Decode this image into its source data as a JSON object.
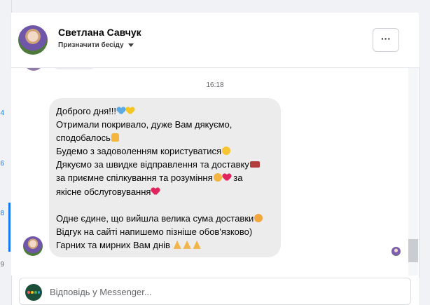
{
  "left_strip": {
    "badges": [
      "4",
      "6",
      "8",
      "9"
    ]
  },
  "header": {
    "contact_name": "Светлана Савчук",
    "subtitle": "Призначити бесіду",
    "more_label": "···"
  },
  "conversation": {
    "timestamp": "16:18",
    "message_lines": [
      "Доброго дня!!!",
      "Отримали покривало, дуже Вам дякуємо,",
      "сподобалось",
      "Будемо з задоволенням користуватися",
      "Дякуємо за швидке відправлення та доставку",
      "за приємне спілкування та розуміння",
      " за",
      "якісне обслуговування",
      "Одне єдине, що вийшла велика сума доставки",
      "Відгук на сайті напишемо пізніше обов'язково)",
      "Гарних та мирних Вам днів"
    ],
    "emoji": [
      "blue-heart",
      "yellow-heart",
      "thumbs-up",
      "smiley",
      "truck",
      "hug",
      "red-heart",
      "sad-face",
      "praying-hands"
    ]
  },
  "composer": {
    "placeholder": "Відповідь у Messenger..."
  },
  "colors": {
    "link_blue": "#1877f2",
    "bubble_gray": "#ececec",
    "messenger_green": "#1c4f3a"
  }
}
